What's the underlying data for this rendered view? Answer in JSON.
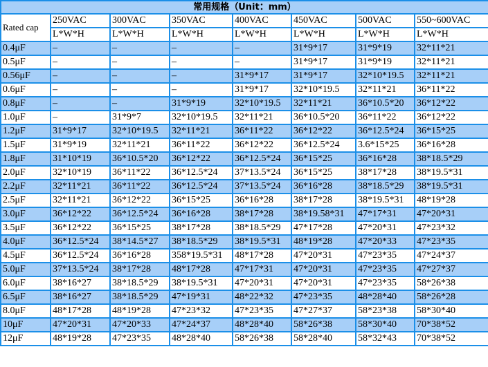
{
  "table": {
    "title": "常用规格（Unit：mm）",
    "rated_cap_label": "Rated cap",
    "voltages": [
      "250VAC",
      "300VAC",
      "350VAC",
      "400VAC",
      "450VAC",
      "500VAC",
      "550~600VAC"
    ],
    "dimension_label": "L*W*H",
    "colors": {
      "border": "#1b8fe8",
      "row_highlight": "#a7cff8",
      "row_plain": "#ffffff"
    },
    "rows": [
      {
        "cap": "0.4μF",
        "values": [
          "–",
          "–",
          "–",
          "–",
          "31*9*17",
          "31*9*19",
          "32*11*21"
        ]
      },
      {
        "cap": "0.5μF",
        "values": [
          "–",
          "–",
          "–",
          "–",
          "31*9*17",
          "31*9*19",
          "32*11*21"
        ]
      },
      {
        "cap": "0.56μF",
        "values": [
          "–",
          "–",
          "–",
          "31*9*17",
          "31*9*17",
          "32*10*19.5",
          "32*11*21"
        ]
      },
      {
        "cap": "0.6μF",
        "values": [
          "–",
          "–",
          "–",
          "31*9*17",
          "32*10*19.5",
          "32*11*21",
          "36*11*22"
        ]
      },
      {
        "cap": "0.8μF",
        "values": [
          "–",
          "–",
          "31*9*19",
          "32*10*19.5",
          "32*11*21",
          "36*10.5*20",
          "36*12*22"
        ]
      },
      {
        "cap": "1.0μF",
        "values": [
          "–",
          "31*9*7",
          "32*10*19.5",
          "32*11*21",
          "36*10.5*20",
          "36*11*22",
          "36*12*22"
        ]
      },
      {
        "cap": "1.2μF",
        "values": [
          "31*9*17",
          "32*10*19.5",
          "32*11*21",
          "36*11*22",
          "36*12*22",
          "36*12.5*24",
          "36*15*25"
        ]
      },
      {
        "cap": "1.5μF",
        "values": [
          "31*9*19",
          "32*11*21",
          "36*11*22",
          "36*12*22",
          "36*12.5*24",
          "3.6*15*25",
          "36*16*28"
        ]
      },
      {
        "cap": "1.8μF",
        "values": [
          "31*10*19",
          "36*10.5*20",
          "36*12*22",
          "36*12.5*24",
          "36*15*25",
          "36*16*28",
          "38*18.5*29"
        ]
      },
      {
        "cap": "2.0μF",
        "values": [
          "32*10*19",
          "36*11*22",
          "36*12.5*24",
          "37*13.5*24",
          "36*15*25",
          "38*17*28",
          "38*19.5*31"
        ]
      },
      {
        "cap": "2.2μF",
        "values": [
          "32*11*21",
          "36*11*22",
          "36*12.5*24",
          "37*13.5*24",
          "36*16*28",
          "38*18.5*29",
          "38*19.5*31"
        ]
      },
      {
        "cap": "2.5μF",
        "values": [
          "32*11*21",
          "36*12*22",
          "36*15*25",
          "36*16*28",
          "38*17*28",
          "38*19.5*31",
          "48*19*28"
        ]
      },
      {
        "cap": "3.0μF",
        "values": [
          "36*12*22",
          "36*12.5*24",
          "36*16*28",
          "38*17*28",
          "38*19.58*31",
          "47*17*31",
          "47*20*31"
        ]
      },
      {
        "cap": "3.5μF",
        "values": [
          "36*12*22",
          "36*15*25",
          "38*17*28",
          "38*18.5*29",
          "47*17*28",
          "47*20*31",
          "47*23*32"
        ]
      },
      {
        "cap": "4.0μF",
        "values": [
          "36*12.5*24",
          "38*14.5*27",
          "38*18.5*29",
          "38*19.5*31",
          "48*19*28",
          "47*20*33",
          "47*23*35"
        ]
      },
      {
        "cap": "4.5μF",
        "values": [
          "36*12.5*24",
          "36*16*28",
          "358*19.5*31",
          "48*17*28",
          "47*20*31",
          "47*23*35",
          "47*24*37"
        ]
      },
      {
        "cap": "5.0μF",
        "values": [
          "37*13.5*24",
          "38*17*28",
          "48*17*28",
          "47*17*31",
          "47*20*31",
          "47*23*35",
          "47*27*37"
        ]
      },
      {
        "cap": "6.0μF",
        "values": [
          "38*16*27",
          "38*18.5*29",
          "38*19.5*31",
          "47*20*31",
          "47*20*31",
          "47*23*35",
          "58*26*38"
        ]
      },
      {
        "cap": "6.5μF",
        "values": [
          "38*16*27",
          "38*18.5*29",
          "47*19*31",
          "48*22*32",
          "47*23*35",
          "48*28*40",
          "58*26*28"
        ]
      },
      {
        "cap": "8.0μF",
        "values": [
          "48*17*28",
          "48*19*28",
          "47*23*32",
          "47*23*35",
          "47*27*37",
          "58*23*38",
          "58*30*40"
        ]
      },
      {
        "cap": "10μF",
        "values": [
          "47*20*31",
          "47*20*33",
          "47*24*37",
          "48*28*40",
          "58*26*38",
          "58*30*40",
          "70*38*52"
        ]
      },
      {
        "cap": "12μF",
        "values": [
          "48*19*28",
          "47*23*35",
          "48*28*40",
          "58*26*38",
          "58*28*40",
          "58*32*43",
          "70*38*52"
        ]
      }
    ]
  }
}
